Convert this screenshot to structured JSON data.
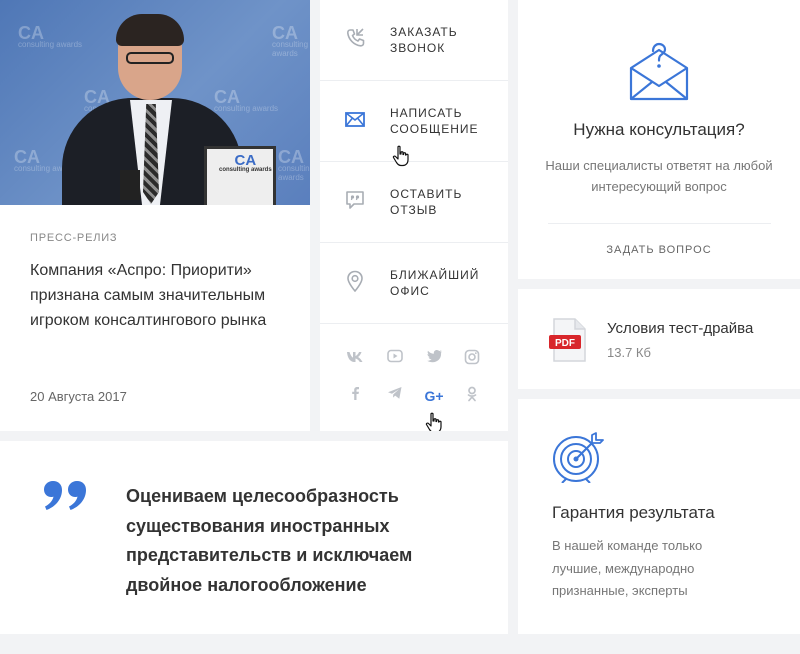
{
  "press": {
    "label": "Пресс-релиз",
    "title": "Компания «Аспро: Приорити» признана самым значительным игроком консалтингового рынка",
    "date": "20 Августа 2017",
    "photo_watermark": "CA",
    "photo_watermark_sub": "consulting awards"
  },
  "actions": [
    {
      "label": "Заказать звонок",
      "icon": "phone-callback-icon"
    },
    {
      "label": "Написать сообщение",
      "icon": "envelope-icon"
    },
    {
      "label": "Оставить отзыв",
      "icon": "chat-review-icon"
    },
    {
      "label": "Ближайший офис",
      "icon": "map-pin-icon"
    }
  ],
  "social": {
    "vk": "vk",
    "telegram": "telegram",
    "google_plus": "G+",
    "odnoklassniki": "ok"
  },
  "quote": {
    "text": "Оцениваем целесообразность существования иностранных представительств и исключаем двойное налогообложение"
  },
  "consultation": {
    "title": "Нужна консультация?",
    "description": "Наши специалисты ответят на любой интересующий вопрос",
    "link": "Задать вопрос"
  },
  "file": {
    "badge": "PDF",
    "name": "Условия тест-драйва",
    "size": "13.7 Кб"
  },
  "guarantee": {
    "title": "Гарантия результата",
    "description": "В нашей команде только лучшие, международно признанные, эксперты"
  },
  "colors": {
    "accent": "#3b76d8",
    "background": "#f2f3f5",
    "pdf_red": "#d8262b",
    "social_grey": "#bfc3c9"
  }
}
